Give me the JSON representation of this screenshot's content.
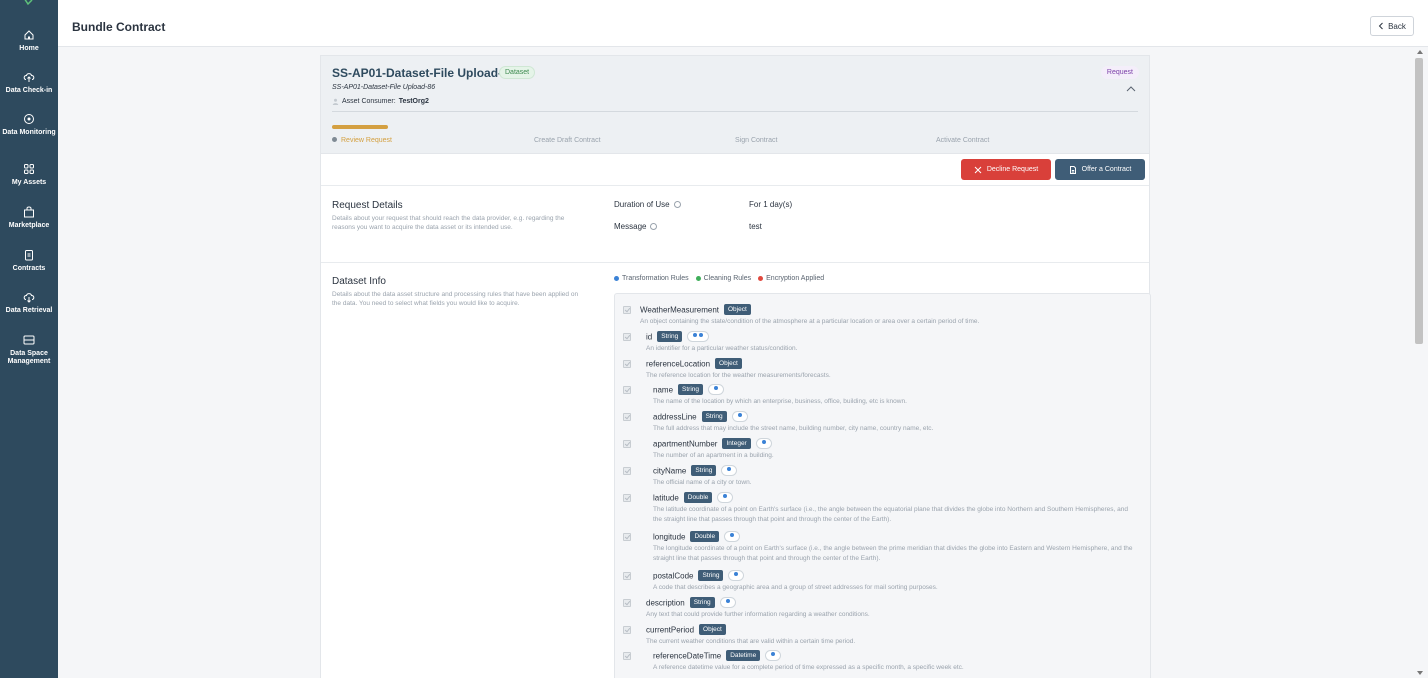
{
  "sidebar": {
    "items": [
      {
        "label": "Home",
        "icon": "home-icon"
      },
      {
        "label": "Data Check-in",
        "icon": "cloud-upload-icon"
      },
      {
        "label": "Data Monitoring",
        "icon": "monitor-icon"
      },
      {
        "label": "My Assets",
        "icon": "grid-icon"
      },
      {
        "label": "Marketplace",
        "icon": "bag-icon"
      },
      {
        "label": "Contracts",
        "icon": "clipboard-icon"
      },
      {
        "label": "Data Retrieval",
        "icon": "cloud-download-icon"
      },
      {
        "label": "Data Space Management",
        "icon": "database-icon"
      }
    ]
  },
  "header": {
    "title": "Bundle Contract",
    "back_label": "Back"
  },
  "asset": {
    "title": "SS-AP01-Dataset-File Upload-86",
    "type_badge": "Dataset",
    "subtitle": "SS-AP01-Dataset-File Upload-86",
    "consumer_label": "Asset Consumer:",
    "consumer_value": "TestOrg2",
    "status_badge": "Request"
  },
  "steps": [
    {
      "label": "Review Request",
      "active": true
    },
    {
      "label": "Create Draft Contract",
      "active": false
    },
    {
      "label": "Sign Contract",
      "active": false
    },
    {
      "label": "Activate Contract",
      "active": false
    }
  ],
  "progress": 0.25,
  "actions": {
    "decline_label": "Decline Request",
    "offer_label": "Offer a Contract"
  },
  "request_details": {
    "title": "Request Details",
    "description": "Details about your request that should reach the data provider, e.g. regarding the reasons you want to acquire the data asset or its intended use.",
    "fields": [
      {
        "label": "Duration of Use",
        "value": "For 1 day(s)"
      },
      {
        "label": "Message",
        "value": "test"
      }
    ]
  },
  "dataset_info": {
    "title": "Dataset Info",
    "description": "Details about the data asset structure and processing rules that have been applied on the data. You need to select what fields you would like to acquire.",
    "legend": [
      {
        "label": "Transformation Rules",
        "color": "#3b82d6"
      },
      {
        "label": "Cleaning Rules",
        "color": "#3fae5a"
      },
      {
        "label": "Encryption Applied",
        "color": "#e0483e"
      }
    ],
    "fields": [
      {
        "name": "WeatherMeasurement",
        "type": "Object",
        "rules": [],
        "description": "An object containing the state/condition of the atmosphere at a particular location or area over a certain period of time."
      },
      {
        "name": "id",
        "type": "String",
        "rules": [
          "#3b82d6",
          "#3b82d6"
        ],
        "description": "An identifier for a particular weather status/condition."
      },
      {
        "name": "referenceLocation",
        "type": "Object",
        "rules": [],
        "description": "The reference location for the weather measurements/forecasts."
      },
      {
        "name": "name",
        "type": "String",
        "rules": [
          "#3b82d6"
        ],
        "description": "The name of the location by which an enterprise, business, office, building, etc is known."
      },
      {
        "name": "addressLine",
        "type": "String",
        "rules": [
          "#3b82d6"
        ],
        "description": "The full address that may include the street name, building number, city name, country name, etc."
      },
      {
        "name": "apartmentNumber",
        "type": "Integer",
        "rules": [
          "#3b82d6"
        ],
        "description": "The number of an apartment in a building."
      },
      {
        "name": "cityName",
        "type": "String",
        "rules": [
          "#3b82d6"
        ],
        "description": "The official name of a city or town."
      },
      {
        "name": "latitude",
        "type": "Double",
        "rules": [
          "#3b82d6"
        ],
        "description": "The latitude coordinate of a point on Earth's surface (i.e., the angle between the equatorial plane that divides the globe into Northern and Southern Hemispheres, and the straight line that passes through that point and through the center of the Earth)."
      },
      {
        "name": "longitude",
        "type": "Double",
        "rules": [
          "#3b82d6"
        ],
        "description": "The longitude coordinate of a point on Earth's surface (i.e., the angle between the prime meridian that divides the globe into Eastern and Western Hemisphere, and the straight line that passes through that point and through the center of the Earth)."
      },
      {
        "name": "postalCode",
        "type": "String",
        "rules": [
          "#3b82d6"
        ],
        "description": "A code that describes a geographic area and a group of street addresses for mail sorting purposes."
      },
      {
        "name": "description",
        "type": "String",
        "rules": [
          "#3b82d6"
        ],
        "description": "Any text that could provide further information regarding a weather conditions."
      },
      {
        "name": "currentPeriod",
        "type": "Object",
        "rules": [],
        "description": "The current weather conditions that are valid within a certain time period."
      },
      {
        "name": "referenceDateTime",
        "type": "Datetime",
        "rules": [
          "#3b82d6"
        ],
        "description": "A reference datetime value for a complete period of time expressed as a specific month, a specific week etc."
      }
    ]
  },
  "colors": {
    "sidebar_bg": "#2e4a5e",
    "accent": "#d4a041",
    "decline": "#d9403a",
    "primary": "#3f5d77"
  }
}
